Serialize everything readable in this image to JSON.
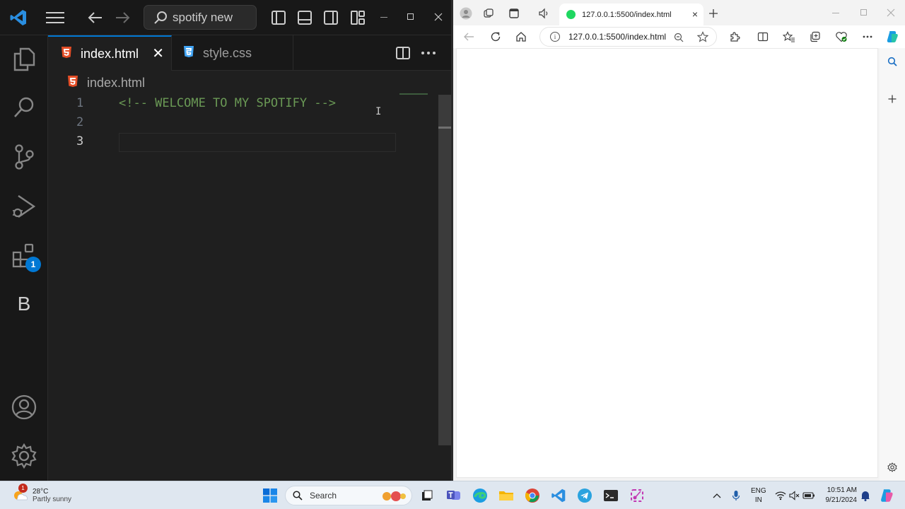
{
  "vscode": {
    "search_text": "spotify new",
    "tabs": [
      {
        "label": "index.html",
        "type": "html",
        "active": true
      },
      {
        "label": "style.css",
        "type": "css",
        "active": false
      }
    ],
    "tab_close_glyph": "✕",
    "breadcrumb": "index.html",
    "extensions_badge": "1",
    "activity_letter": "B",
    "line_numbers": [
      "1",
      "2",
      "3"
    ],
    "code_lines": [
      "<!-- WELCOME TO MY SPOTIFY -->",
      "",
      ""
    ],
    "active_line": 3,
    "colors": {
      "accent": "#0078d4",
      "comment": "#6a9955",
      "html_icon": "#e44d26",
      "css_icon": "#42a5f5"
    }
  },
  "edge": {
    "tab_title": "127.0.0.1:5500/index.html",
    "address": "127.0.0.1:5500/index.html",
    "favicon_color": "#1ed760"
  },
  "taskbar": {
    "weather_temp": "28°C",
    "weather_desc": "Partly sunny",
    "weather_badge": "1",
    "search_label": "Search",
    "lang_line1": "ENG",
    "lang_line2": "IN",
    "time": "10:51 AM",
    "date": "9/21/2024"
  }
}
